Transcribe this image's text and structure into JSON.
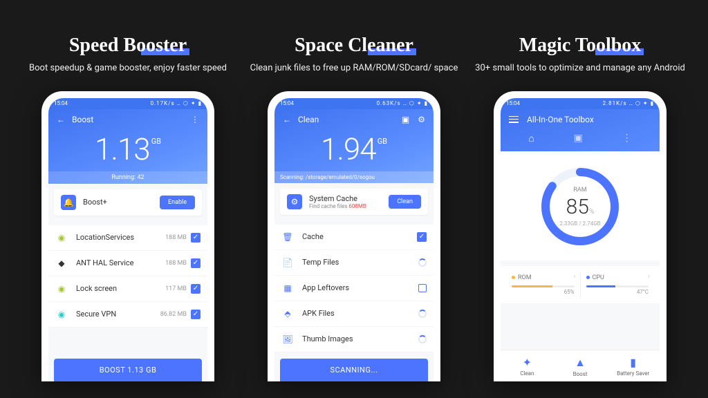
{
  "columns": {
    "boost": {
      "title": "Speed Booster",
      "subtitle": "Boot speedup & game booster, enjoy faster speed"
    },
    "clean": {
      "title": "Space Cleaner",
      "subtitle": "Clean junk files to free up RAM/ROM/SDcard/ space"
    },
    "tool": {
      "title": "Magic Toolbox",
      "subtitle": "30+ small tools to optimize and manage any Android"
    }
  },
  "status": {
    "time": "15:04",
    "net1": "0.17K/s",
    "net2": "0.63K/s",
    "net3": "2.81K/s",
    "icons": "… ⬡ ✦ ▮"
  },
  "boost": {
    "header": "Boost",
    "value": "1.13",
    "unit": "GB",
    "running": "Running: 42",
    "plus_label": "Boost+",
    "plus_btn": "Enable",
    "items": [
      {
        "name": "LocationServices",
        "size": "188 MB",
        "icon": "android",
        "color": "#a4c639"
      },
      {
        "name": "ANT HAL Service",
        "size": "188 MB",
        "icon": "share",
        "color": "#333"
      },
      {
        "name": "Lock screen",
        "size": "117 MB",
        "icon": "android",
        "color": "#a4c639"
      },
      {
        "name": "Secure VPN",
        "size": "86.82 MB",
        "icon": "vpn",
        "color": "#31c9c9"
      }
    ],
    "action": "BOOST 1.13 GB"
  },
  "clean": {
    "header": "Clean",
    "value": "1.94",
    "unit": "GB",
    "scanning_path": "Scanning: /storage/emulated/0/sogou",
    "syscache_title": "System Cache",
    "syscache_sub_prefix": "Find cache files ",
    "syscache_size": "608MB",
    "syscache_btn": "Clean",
    "rows": [
      {
        "name": "Cache",
        "type": "check"
      },
      {
        "name": "Temp Files",
        "type": "spin"
      },
      {
        "name": "App Leftovers",
        "type": "box"
      },
      {
        "name": "APK Files",
        "type": "spin"
      },
      {
        "name": "Thumb Images",
        "type": "spin"
      }
    ],
    "action": "SCANNING..."
  },
  "tool": {
    "header": "All-In-One Toolbox",
    "gauge_label": "RAM",
    "gauge_pct": "85",
    "gauge_range": "2.33GB / 2.74GB",
    "stats": {
      "rom": {
        "label": "ROM",
        "value": "65%",
        "dotColor": "#ffb347",
        "pct": 65
      },
      "cpu": {
        "label": "CPU",
        "value": "47°C",
        "dotColor": "#4d74ff",
        "pct": 47
      }
    },
    "bottom": [
      {
        "label": "Clean",
        "glyph": "✦"
      },
      {
        "label": "Boost",
        "glyph": "▲"
      },
      {
        "label": "Battery Saver",
        "glyph": "▮"
      }
    ]
  }
}
